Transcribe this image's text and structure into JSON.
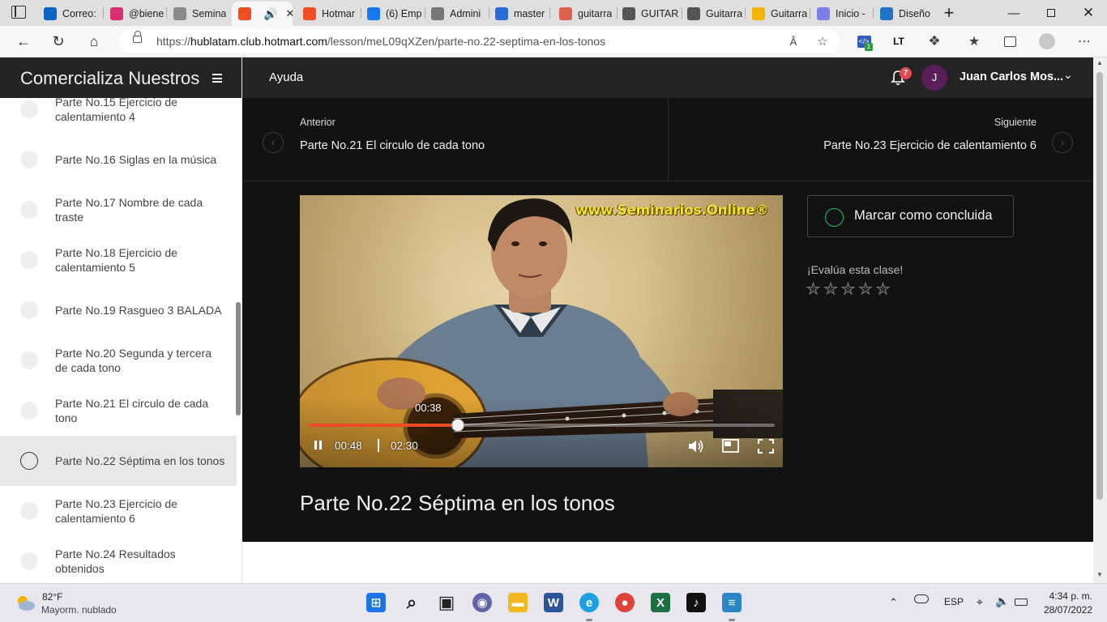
{
  "browser": {
    "tabs": [
      {
        "label": "Correo:",
        "icon": "outlook-icon",
        "color": "#0a64c2"
      },
      {
        "label": "@biene",
        "icon": "instagram-icon",
        "color": "#d6306f"
      },
      {
        "label": "Semina",
        "icon": "seminarios-icon",
        "color": "#8a8a8a"
      },
      {
        "label": "",
        "icon": "hotmart-icon",
        "color": "#f04e23",
        "active": true
      },
      {
        "label": "Hotmar",
        "icon": "hotmart-icon",
        "color": "#f04e23"
      },
      {
        "label": "(6) Emp",
        "icon": "facebook-icon",
        "color": "#1877f2"
      },
      {
        "label": "Admini",
        "icon": "admin-icon",
        "color": "#777"
      },
      {
        "label": "master",
        "icon": "search-icon",
        "color": "#2a6bd6"
      },
      {
        "label": "guitarra",
        "icon": "pinterest-icon",
        "color": "#e0604e"
      },
      {
        "label": "GUITAR",
        "icon": "document-icon",
        "color": "#555"
      },
      {
        "label": "Guitarra",
        "icon": "document-icon",
        "color": "#555"
      },
      {
        "label": "Guitarra",
        "icon": "google-drive-icon",
        "color": "#f4b400"
      },
      {
        "label": "Inicio -",
        "icon": "canva-icon",
        "color": "#7d7fe8"
      },
      {
        "label": "Diseño",
        "icon": "canva-icon",
        "color": "#2075c6"
      }
    ],
    "url_prefix": "https://",
    "url_host": "hublatam.club.hotmart.com",
    "url_path": "/lesson/meL09qXZen/parte-no.22-septima-en-los-tonos",
    "extension_badge": "1",
    "extension_lt": "LT"
  },
  "sidebar": {
    "title": "Comercializa Nuestros",
    "lessons": [
      {
        "label": "Parte No.15 Ejercicio de calentamiento 4",
        "active": false
      },
      {
        "label": "Parte No.16 Siglas en la música",
        "active": false
      },
      {
        "label": "Parte No.17 Nombre de cada traste",
        "active": false
      },
      {
        "label": "Parte No.18 Ejercicio de calentamiento 5",
        "active": false
      },
      {
        "label": "Parte No.19 Rasgueo 3 BALADA",
        "active": false
      },
      {
        "label": "Parte No.20 Segunda y tercera de cada tono",
        "active": false
      },
      {
        "label": "Parte No.21 El circulo de cada tono",
        "active": false
      },
      {
        "label": "Parte No.22 Séptima en los tonos",
        "active": true
      },
      {
        "label": "Parte No.23 Ejercicio de calentamiento 6",
        "active": false
      },
      {
        "label": "Parte No.24 Resultados obtenidos",
        "active": false
      }
    ]
  },
  "topbar": {
    "help": "Ayuda",
    "notifications": "7",
    "avatar_initial": "J",
    "user_name": "Juan Carlos Mos..."
  },
  "lesson_nav": {
    "prev_small": "Anterior",
    "prev_title": "Parte No.21 El circulo de cada tono",
    "next_small": "Siguiente",
    "next_title": "Parte No.23 Ejercicio de calentamiento 6"
  },
  "video": {
    "watermark": "www.Seminarios.Online®",
    "hover_time": "00:38",
    "current_time": "00:48",
    "duration": "02:30",
    "progress_fraction": 0.32
  },
  "lesson": {
    "title": "Parte No.22 Séptima en los tonos",
    "mark_done": "Marcar como concluida",
    "rate_label": "¡Evalúa esta clase!",
    "rating_stars": 5,
    "rating_value": 0
  },
  "taskbar": {
    "temperature": "82°F",
    "weather": "Mayorm. nublado",
    "language": "ESP",
    "time": "4:34 p. m.",
    "date": "28/07/2022",
    "apps": [
      {
        "icon": "windows-start-icon",
        "color": "#1a73e8"
      },
      {
        "icon": "search-icon",
        "color": "#222"
      },
      {
        "icon": "task-view-icon",
        "color": "#222"
      },
      {
        "icon": "teams-chat-icon",
        "color": "#6264a7"
      },
      {
        "icon": "file-explorer-icon",
        "color": "#f2b71f"
      },
      {
        "icon": "word-icon",
        "color": "#2b579a"
      },
      {
        "icon": "edge-icon",
        "color": "#1ba1e2"
      },
      {
        "icon": "chrome-icon",
        "color": "#db4437"
      },
      {
        "icon": "excel-icon",
        "color": "#1d7044"
      },
      {
        "icon": "tiktok-icon",
        "color": "#111"
      },
      {
        "icon": "notepad-icon",
        "color": "#2b86c5"
      }
    ]
  },
  "colors": {
    "accent_progress": "#f04a24",
    "check_green": "#27c26b",
    "header_bg": "#232323",
    "content_bg": "#121212"
  }
}
